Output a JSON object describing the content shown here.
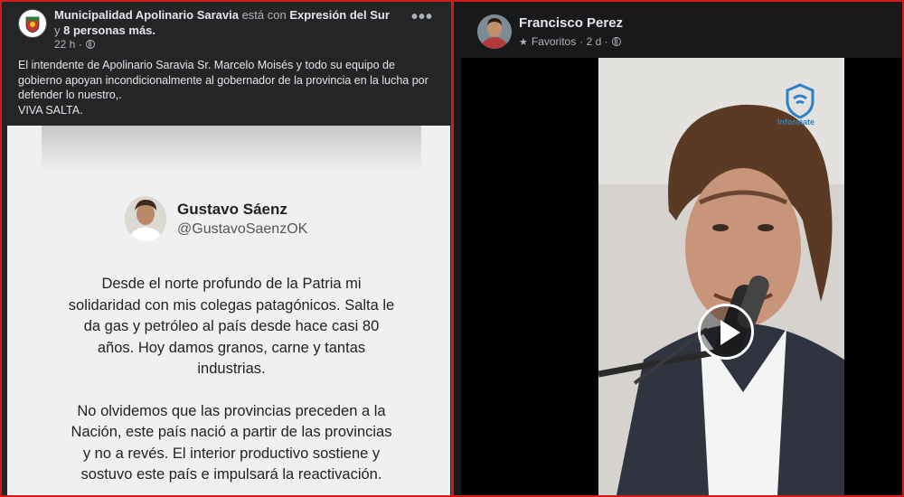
{
  "left_post": {
    "author": "Municipalidad Apolinario Saravia",
    "with_text": "está con",
    "tagged": "Expresión del Sur",
    "and_text": "y",
    "others": "8 personas más.",
    "time": "22 h ·",
    "more": "•••",
    "text_lines": [
      "El intendente de Apolinario Saravia Sr. Marcelo Moisés y todo su equipo de",
      "gobierno apoyan incondicionalmente al gobernador de la provincia en la lucha por",
      "defender lo nuestro,.",
      "VIVA SALTA."
    ],
    "tweet": {
      "name": "Gustavo Sáenz",
      "handle": "@GustavoSaenzOK",
      "paragraph1": "Desde el norte profundo de la Patria mi solidaridad con mis colegas patagónicos. Salta le da gas y petróleo al país desde hace casi 80 años. Hoy damos granos, carne y tantas industrias.",
      "paragraph2": "No olvidemos que las provincias preceden a la Nación, este país nació a partir de las provincias y no a revés. El interior productivo sostiene y sostuvo este país e impulsará la reactivación."
    }
  },
  "right_post": {
    "author": "Francisco Perez",
    "audience": "Favoritos",
    "time": "· 2 d ·",
    "video_brand": "Informate"
  },
  "colors": {
    "frame_border": "#d11a1a",
    "card_bg": "#242526",
    "video_bg": "#000000"
  },
  "icons": [
    "more-options-icon",
    "globe-icon",
    "star-icon",
    "play-icon"
  ]
}
